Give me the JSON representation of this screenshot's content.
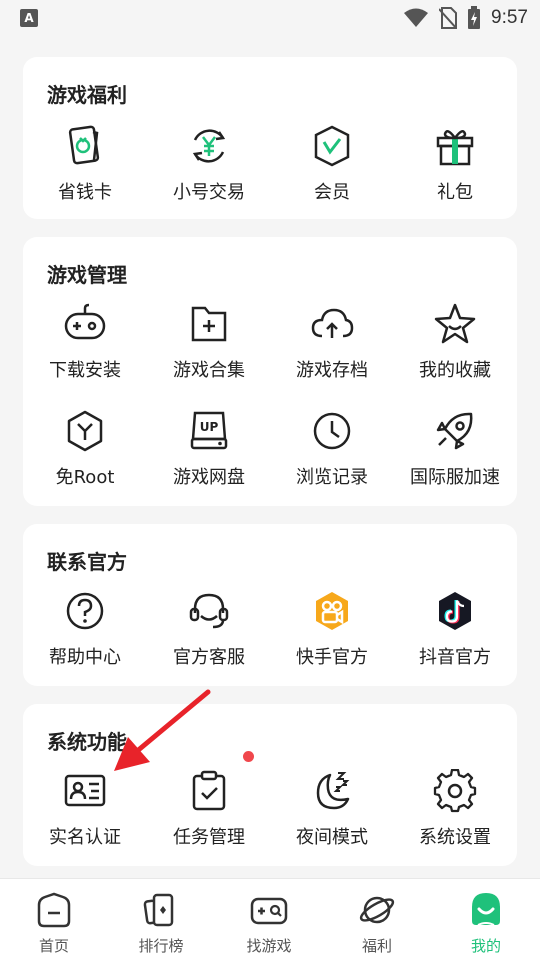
{
  "status_bar": {
    "time": "9:57",
    "left_badge": "A"
  },
  "sections": {
    "welfare": {
      "title": "游戏福利",
      "items": [
        {
          "label": "省钱卡",
          "icon": "savings-card-icon"
        },
        {
          "label": "小号交易",
          "icon": "yen-exchange-icon"
        },
        {
          "label": "会员",
          "icon": "vip-shield-icon"
        },
        {
          "label": "礼包",
          "icon": "gift-icon"
        }
      ]
    },
    "management": {
      "title": "游戏管理",
      "items": [
        {
          "label": "下载安装",
          "icon": "gamepad-icon"
        },
        {
          "label": "游戏合集",
          "icon": "folder-plus-icon"
        },
        {
          "label": "游戏存档",
          "icon": "cloud-upload-icon"
        },
        {
          "label": "我的收藏",
          "icon": "star-icon"
        },
        {
          "label": "免Root",
          "icon": "hexagon-y-icon"
        },
        {
          "label": "游戏网盘",
          "icon": "up-disk-icon"
        },
        {
          "label": "浏览记录",
          "icon": "clock-icon"
        },
        {
          "label": "国际服加速",
          "icon": "rocket-icon"
        }
      ]
    },
    "official": {
      "title": "联系官方",
      "items": [
        {
          "label": "帮助中心",
          "icon": "help-icon"
        },
        {
          "label": "官方客服",
          "icon": "headset-icon"
        },
        {
          "label": "快手官方",
          "icon": "kuaishou-icon"
        },
        {
          "label": "抖音官方",
          "icon": "douyin-icon"
        }
      ]
    },
    "system": {
      "title": "系统功能",
      "items": [
        {
          "label": "实名认证",
          "icon": "id-card-icon"
        },
        {
          "label": "任务管理",
          "icon": "clipboard-check-icon"
        },
        {
          "label": "夜间模式",
          "icon": "moon-icon"
        },
        {
          "label": "系统设置",
          "icon": "gear-icon"
        }
      ]
    }
  },
  "bottom_nav": [
    {
      "label": "首页",
      "icon": "home-icon"
    },
    {
      "label": "排行榜",
      "icon": "ranking-icon"
    },
    {
      "label": "找游戏",
      "icon": "find-game-icon"
    },
    {
      "label": "福利",
      "icon": "planet-icon"
    },
    {
      "label": "我的",
      "icon": "profile-icon",
      "active": true
    }
  ],
  "colors": {
    "accent": "#1fc17b",
    "dot": "#f0474c",
    "arrow": "#e8232a"
  }
}
